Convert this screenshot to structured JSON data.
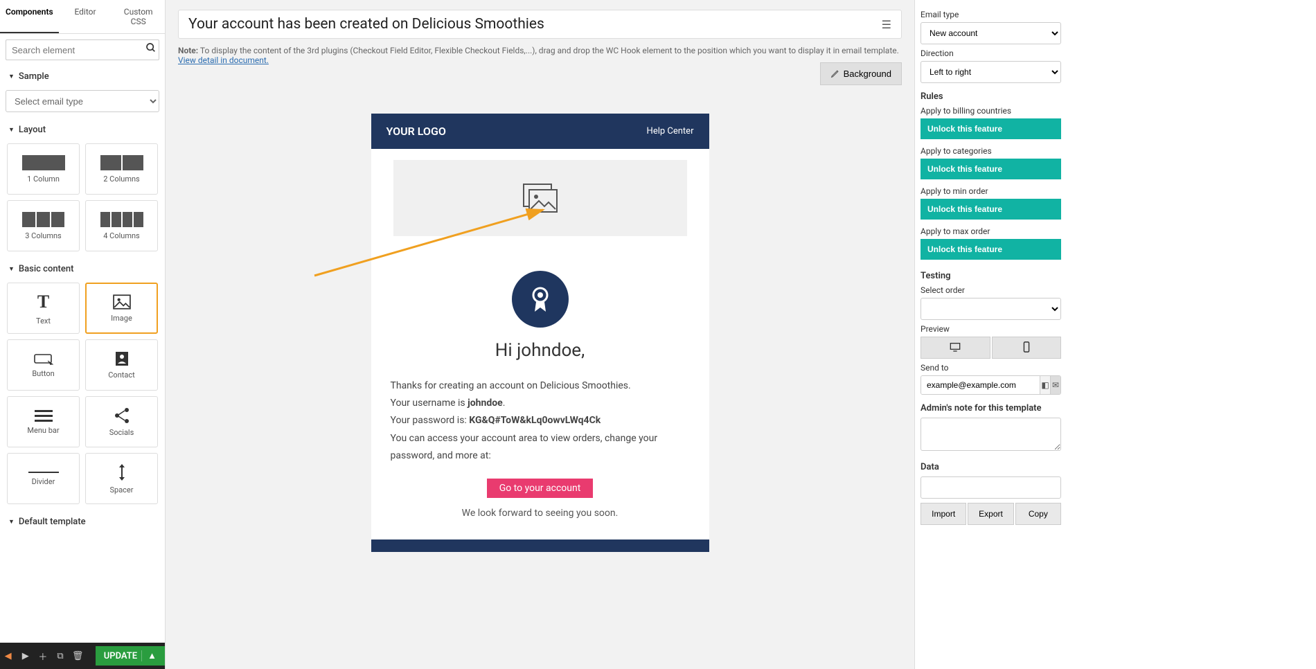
{
  "tabs": {
    "components": "Components",
    "editor": "Editor",
    "custom_css": "Custom CSS"
  },
  "search": {
    "placeholder": "Search element"
  },
  "sections": {
    "sample": "Sample",
    "sample_placeholder": "Select email type",
    "layout": "Layout",
    "basic_content": "Basic content",
    "default_template": "Default template"
  },
  "layout_tiles": [
    "1 Column",
    "2 Columns",
    "3 Columns",
    "4 Columns"
  ],
  "basic_tiles": [
    "Text",
    "Image",
    "Button",
    "Contact",
    "Menu bar",
    "Socials",
    "Divider",
    "Spacer"
  ],
  "bottom": {
    "update": "UPDATE"
  },
  "canvas": {
    "title": "Your account has been created on Delicious Smoothies",
    "note_bold": "Note:",
    "note": "To display the content of the 3rd plugins (Checkout Field Editor, Flexible Checkout Fields,...), drag and drop the WC Hook element to the position which you want to display it in email template.",
    "note_link": "View detail in document.",
    "background_btn": "Background"
  },
  "email": {
    "logo": "YOUR LOGO",
    "help": "Help Center",
    "greeting": "Hi johndoe,",
    "line1": "Thanks for creating an account on Delicious Smoothies.",
    "line2a": "Your username is ",
    "line2b": "johndoe",
    "line3a": "Your password is: ",
    "line3b": "KG&Q#ToW&kLq0owvLWq4Ck",
    "line4": "You can access your account area to view orders, change your password, and more at:",
    "cta": "Go to your account",
    "closing": "We look forward to seeing you soon."
  },
  "right": {
    "email_type": "Email type",
    "email_type_val": "New account",
    "direction": "Direction",
    "direction_val": "Left to right",
    "rules": "Rules",
    "billing": "Apply to billing countries",
    "categories": "Apply to categories",
    "min_order": "Apply to min order",
    "max_order": "Apply to max order",
    "unlock": "Unlock this feature",
    "testing": "Testing",
    "select_order": "Select order",
    "preview": "Preview",
    "send_to": "Send to",
    "send_to_val": "example@example.com",
    "admin_note": "Admin's note for this template",
    "data": "Data",
    "import": "Import",
    "export": "Export",
    "copy": "Copy"
  }
}
